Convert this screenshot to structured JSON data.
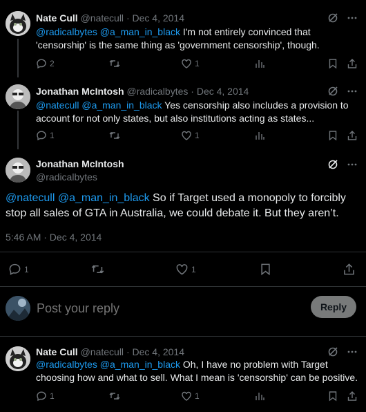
{
  "tweets": [
    {
      "name": "Nate Cull",
      "handle": "@natecull",
      "dot": "·",
      "date": "Dec 4, 2014",
      "mentions": "@radicalbytes @a_man_in_black",
      "text": " I'm not entirely convinced that 'censorship' is the same thing as 'government censorship', though.",
      "replies": "2",
      "retweets": "",
      "likes": "1"
    },
    {
      "name": "Jonathan McIntosh",
      "handle": "@radicalbytes",
      "dot": "·",
      "date": "Dec 4, 2014",
      "mentions": "@natecull @a_man_in_black",
      "text": " Yes censorship also includes a provision to account for not only states, but also institutions acting as states...",
      "replies": "1",
      "retweets": "",
      "likes": "1"
    },
    {
      "name": "Nate Cull",
      "handle": "@natecull",
      "dot": "·",
      "date": "Dec 4, 2014",
      "mentions": "@radicalbytes @a_man_in_black",
      "text": " Oh, I have no problem with Target choosing how and what to sell. What I mean is 'censorship' can be positive.",
      "replies": "1",
      "retweets": "",
      "likes": "1"
    }
  ],
  "main": {
    "name": "Jonathan McIntosh",
    "handle": "@radicalbytes",
    "mentions": "@natecull @a_man_in_black",
    "text": " So if Target used a monopoly to forcibly stop all sales of GTA in Australia, we could debate it. But they aren’t.",
    "timestamp": "5:46 AM · Dec 4, 2014",
    "replies": "1",
    "likes": "1"
  },
  "reply": {
    "placeholder": "Post your reply",
    "button": "Reply"
  },
  "colors": {
    "accent": "#1d9bf0",
    "muted": "#71767b",
    "text": "#e7e9ea",
    "background": "#000000"
  }
}
